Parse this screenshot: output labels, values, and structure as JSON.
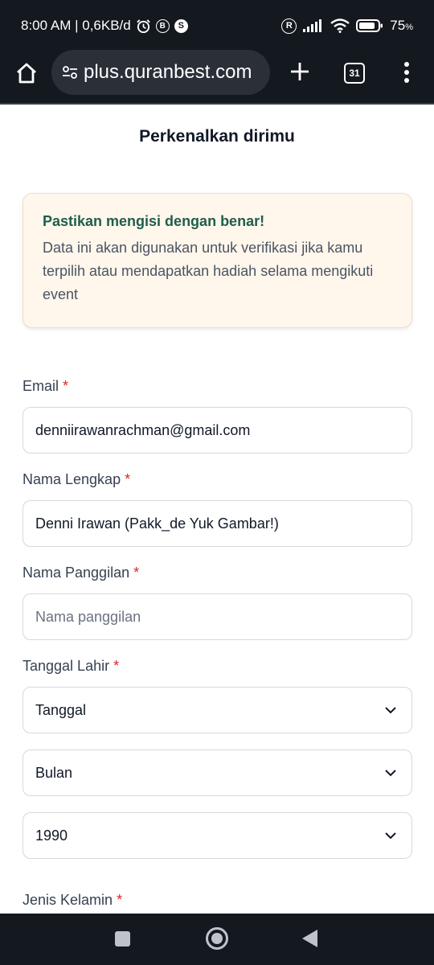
{
  "status_bar": {
    "time_text": "8:00 AM | 0,6KB/d",
    "icons": [
      "alarm-icon",
      "b-circle-icon",
      "s-circle-icon",
      "r-circle-icon",
      "signal-icon",
      "wifi-icon",
      "battery-icon"
    ],
    "b_letter": "B",
    "s_letter": "S",
    "r_letter": "R",
    "battery_percent": "75",
    "battery_unit": "%"
  },
  "browser": {
    "url_text": "plus.quranbest.com",
    "tab_count": "31"
  },
  "page": {
    "title": "Perkenalkan dirimu"
  },
  "notice": {
    "title": "Pastikan mengisi dengan benar!",
    "body": "Data ini akan digunakan untuk verifikasi jika kamu terpilih atau mendapatkan hadiah selama mengikuti event",
    "colors": {
      "background": "#fff6ec",
      "title": "#1f5e4a"
    }
  },
  "form": {
    "required_marker": "*",
    "email": {
      "label": "Email",
      "value": "denniirawanrachman@gmail.com"
    },
    "full_name": {
      "label": "Nama Lengkap",
      "value": "Denni Irawan (Pakk_de Yuk Gambar!)"
    },
    "nickname": {
      "label": "Nama Panggilan",
      "placeholder": "Nama panggilan",
      "value": ""
    },
    "birth_date": {
      "label": "Tanggal Lahir",
      "day_value": "Tanggal",
      "month_value": "Bulan",
      "year_value": "1990"
    },
    "gender": {
      "label": "Jenis Kelamin"
    }
  },
  "colors": {
    "required": "#dc2626",
    "system_bar": "#14181f"
  }
}
